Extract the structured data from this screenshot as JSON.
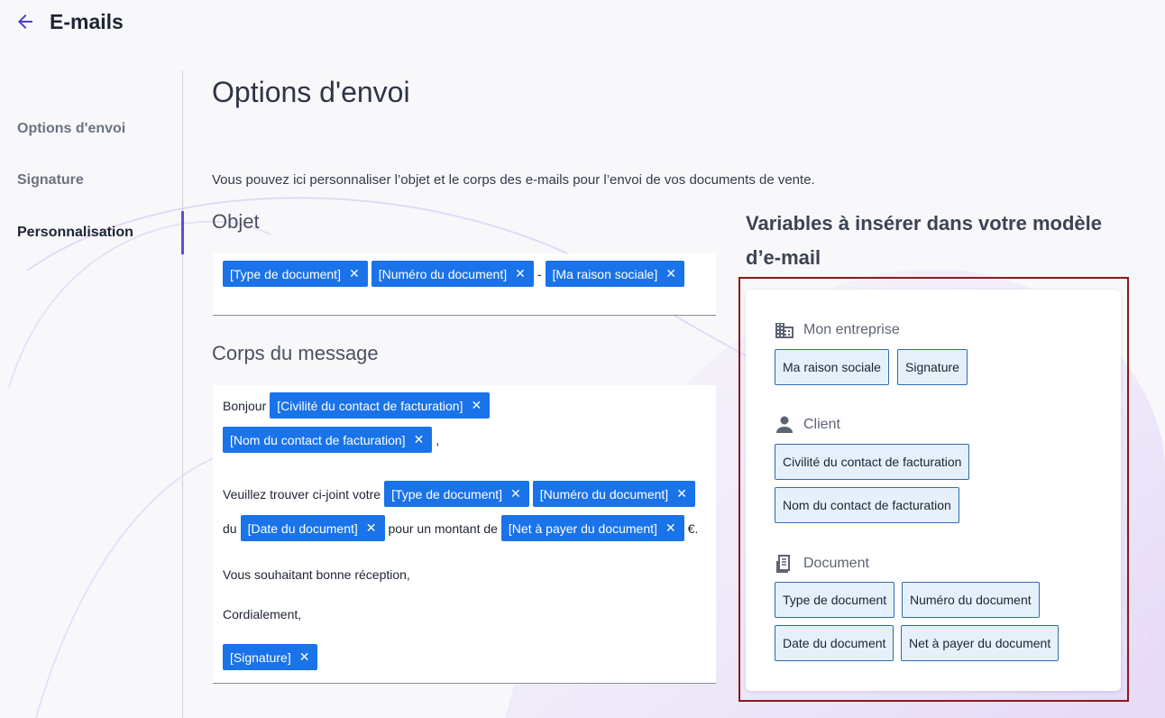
{
  "header": {
    "title": "E-mails",
    "back_icon": "arrow-left-icon"
  },
  "sidebar": {
    "items": [
      {
        "label": "Options d'envoi",
        "active": false
      },
      {
        "label": "Signature",
        "active": false
      },
      {
        "label": "Personnalisation",
        "active": true
      }
    ]
  },
  "main": {
    "page_title": "Options d'envoi",
    "intro": "Vous pouvez ici personnaliser l’objet et le corps des e-mails pour l’envoi de vos documents de vente.",
    "objet": {
      "title": "Objet",
      "chips": [
        "[Type de document]",
        "[Numéro du document]",
        "[Ma raison sociale]"
      ],
      "separator": "-"
    },
    "corps": {
      "title": "Corps du message",
      "greeting": "Bonjour",
      "chip_civilite": "[Civilité du contact de facturation]",
      "chip_nom": "[Nom du contact de facturation]",
      "comma": ",",
      "veuillez": "Veuillez trouver ci-joint votre",
      "chip_type": "[Type de document]",
      "chip_numero": "[Numéro du document]",
      "du": "du",
      "chip_date": "[Date du document]",
      "montant": "pour un montant de",
      "chip_net": "[Net à payer du document]",
      "euro": "€.",
      "souhait": "Vous souhaitant bonne réception,",
      "cordialement": "Cordialement,",
      "chip_signature": "[Signature]"
    },
    "remove_symbol": "✕"
  },
  "variables": {
    "heading": "Variables à insérer dans votre modèle d’e-mail",
    "groups": [
      {
        "label": "Mon entreprise",
        "icon": "building-icon",
        "items": [
          "Ma raison sociale",
          "Signature"
        ]
      },
      {
        "label": "Client",
        "icon": "person-icon",
        "items": [
          "Civilité du contact de facturation",
          "Nom du contact de facturation"
        ]
      },
      {
        "label": "Document",
        "icon": "document-icon",
        "items": [
          "Type de document",
          "Numéro du document",
          "Date du document",
          "Net à payer du document"
        ]
      }
    ]
  },
  "colors": {
    "chip": "#1a73e8",
    "accent": "#5b4fd6",
    "highlight_outline": "#8b1a1a",
    "var_button_bg": "#e6f0fa"
  }
}
